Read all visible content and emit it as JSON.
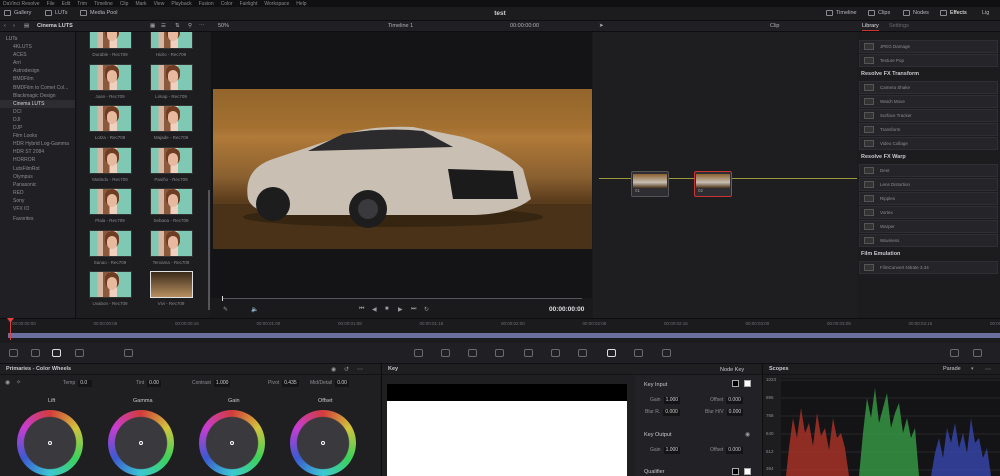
{
  "menubar": [
    "DaVinci Resolve",
    "File",
    "Edit",
    "Trim",
    "Timeline",
    "Clip",
    "Mark",
    "View",
    "Playback",
    "Fusion",
    "Color",
    "Fairlight",
    "Workspace",
    "Help"
  ],
  "topbar": {
    "gallery": "Gallery",
    "luts": "LUTs",
    "media_pool": "Media Pool",
    "project": "test",
    "timeline": "Timeline",
    "clips": "Clips",
    "nodes": "Nodes",
    "effects": "Effects",
    "light": "Lig"
  },
  "panelbar": {
    "lut_folder": "Cinema LUTS",
    "zoom": "50%",
    "timeline_name": "Timeline 1",
    "timecode": "00:00:00:00",
    "clip": "Clip",
    "library": "Library",
    "settings": "Settings"
  },
  "lut_groups": [
    "LUTs",
    "4KLUTS",
    "ACES",
    "Arri",
    "Astrodesign",
    "BMDFilm",
    "BMDFilm to Comet Col...",
    "Blackmagic Design",
    "Cinema LUTS",
    "DCI",
    "DJI",
    "DJP",
    "Film Looks",
    "HDR Hybrid Log-Gamma",
    "HDR ST 2084",
    "HORROR",
    "LutsFilmRot",
    "Olympus",
    "Panasonic",
    "RED",
    "Sony",
    "VFX IO",
    "Favorites"
  ],
  "thumbnails": [
    {
      "label": "Durable - Rec709"
    },
    {
      "label": "Hidro - Rec709"
    },
    {
      "label": "Juan - Rec709"
    },
    {
      "label": "Limap - Rec709"
    },
    {
      "label": "Lotza - Rec709"
    },
    {
      "label": "Majade - Rec709"
    },
    {
      "label": "Matindo - Rec709"
    },
    {
      "label": "Pasiño - Rec709"
    },
    {
      "label": "Plala - Rec709"
    },
    {
      "label": "Sebana - Rec709"
    },
    {
      "label": "Sanao - Rec709"
    },
    {
      "label": "Tervama - Rec709"
    },
    {
      "label": "Uvabon - Rec709"
    },
    {
      "label": "Vivi - Rec709"
    }
  ],
  "viewer": {
    "timecode": "00:00:00:00"
  },
  "nodes": {
    "node1": "01",
    "node2": "02"
  },
  "library": {
    "pre_items": [
      "JPEG Damage",
      "Texture Pop"
    ],
    "sections": [
      {
        "title": "Resolve FX Transform",
        "items": [
          "Camera Shake",
          "Watch Move",
          "Surface Tracker",
          "Transform",
          "Video Collage"
        ]
      },
      {
        "title": "Resolve FX Warp",
        "items": [
          "Dent",
          "Lens Distortion",
          "Ripples",
          "Vortex",
          "Warper",
          "Waviness"
        ]
      },
      {
        "title": "Film Emulation",
        "items": [
          "FilmConvert Nitrate 3.34"
        ]
      }
    ]
  },
  "timeline_ruler": [
    "00:00:00:00",
    "00:00:00:08",
    "00:00:00:16",
    "00:00:01:00",
    "00:00:01:08",
    "00:00:01:16",
    "00:00:02:00",
    "00:00:02:08",
    "00:00:02:16",
    "00:00:03:00",
    "00:00:03:08",
    "00:00:03:16",
    "00:00:04:00"
  ],
  "primaries": {
    "title": "Primaries - Color Wheels",
    "temp_label": "Temp",
    "temp": "0.0",
    "tint_label": "Tint",
    "tint": "0.00",
    "contrast_label": "Contrast",
    "contrast": "1.000",
    "pivot_label": "Pivot",
    "pivot": "0.435",
    "middetail_label": "Mid/Detail",
    "middetail": "0.00",
    "wheels": [
      "Lift",
      "Gamma",
      "Gain",
      "Offset"
    ]
  },
  "key": {
    "title": "Key",
    "node_key": "Node Key",
    "key_input": "Key Input",
    "key_output": "Key Output",
    "qualifier": "Qualifier",
    "gain_label": "Gain",
    "gain": "1.000",
    "offset_label": "Offset",
    "offset": "0.000",
    "blur_r_label": "Blur R.",
    "blur_r": "0.000",
    "blur_hv_label": "Blur H/V",
    "blur_hv": "0.000",
    "out_gain": "1.000",
    "out_offset": "0.000"
  },
  "scopes": {
    "title": "Scopes",
    "mode": "Parade",
    "scale": [
      "1023",
      "896",
      "768",
      "640",
      "512",
      "384"
    ]
  }
}
